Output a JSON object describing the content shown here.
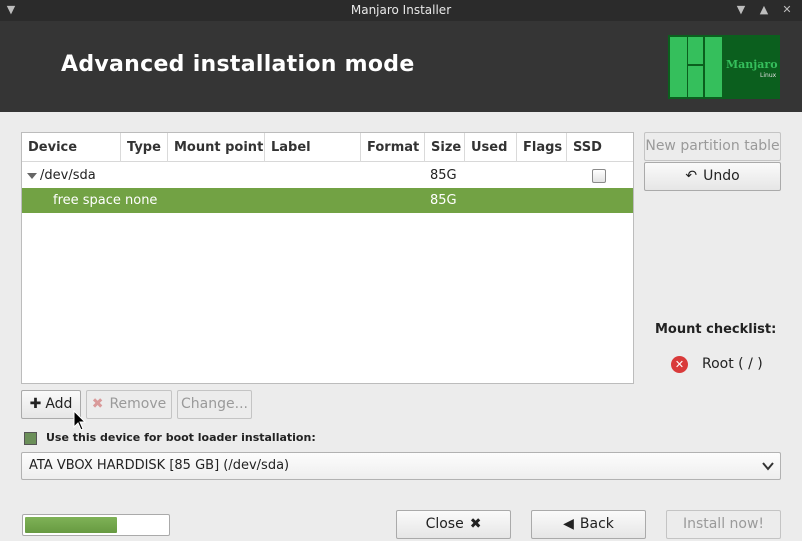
{
  "window": {
    "title": "Manjaro Installer"
  },
  "header": {
    "heading": "Advanced installation mode",
    "logo_text": "Manjaro",
    "logo_subtext": "Linux",
    "brand_color": "#35bf5c"
  },
  "partition_table": {
    "columns": [
      "Device",
      "Type",
      "Mount point",
      "Label",
      "Format",
      "Size",
      "Used",
      "Flags",
      "SSD"
    ],
    "rows": [
      {
        "device": "/dev/sda",
        "type": "",
        "mount_point": "",
        "label": "",
        "format": "",
        "size": "85G",
        "used": "",
        "flags": "",
        "ssd": false
      },
      {
        "device": "free space",
        "type": "none",
        "mount_point": "",
        "label": "",
        "format": "",
        "size": "85G",
        "used": "",
        "flags": "",
        "selected": true
      }
    ],
    "selected_row_color": "#72a244"
  },
  "side_buttons": {
    "new_partition_table": "New partition table",
    "undo": "Undo"
  },
  "action_buttons": {
    "add": "Add",
    "remove": "Remove",
    "change": "Change..."
  },
  "mount_checklist": {
    "title": "Mount checklist:",
    "items": [
      {
        "label": "Root ( / )",
        "status": "missing",
        "icon": "error-circle-icon"
      }
    ]
  },
  "bootloader": {
    "checkbox_label": "Use this device for boot loader installation:",
    "checked": true,
    "device": "ATA VBOX HARDDISK [85 GB] (/dev/sda)"
  },
  "footer": {
    "progress": 0.64,
    "progress_color": "#72a244",
    "close": "Close",
    "back": "Back",
    "install": "Install now!"
  }
}
